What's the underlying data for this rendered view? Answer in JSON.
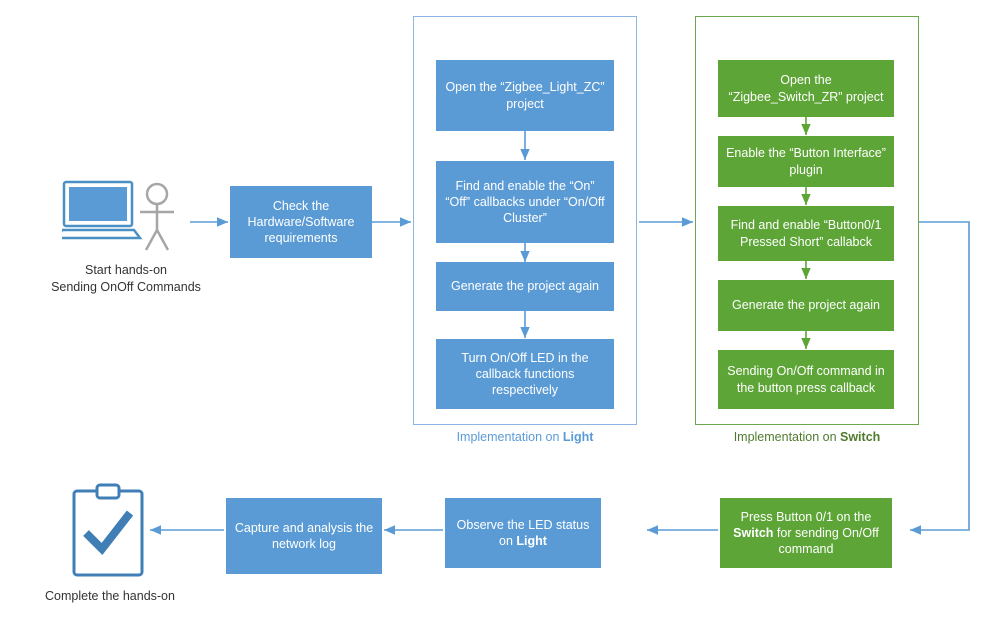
{
  "diagram": {
    "title": "Zigbee hands-on flow diagram",
    "colors": {
      "blue": "#5b9bd5",
      "green": "#5da536",
      "blue_caption": "#5b9bd5",
      "green_caption": "#4f7b2e",
      "arrow": "#5b9bd5",
      "group_blue_border": "#8eb4e3",
      "group_green_border": "#6aa84f"
    },
    "start": {
      "label_line1": "Start hands-on",
      "label_line2": "Sending OnOff Commands",
      "icon": "laptop-and-person-icon"
    },
    "end": {
      "label": "Complete the hands-on",
      "icon": "clipboard-check-icon"
    },
    "nodes": {
      "check_requirements": "Check the Hardware/Software requirements",
      "light": [
        "Open the “Zigbee_Light_ZC” project",
        "Find and enable the “On” “Off” callbacks under “On/Off Cluster”",
        "Generate the project again",
        "Turn On/Off LED in the callback functions respectively"
      ],
      "switch": [
        "Open the “Zigbee_Switch_ZR” project",
        "Enable the “Button Interface” plugin",
        "Find and enable “Button0/1 Pressed Short” callabck",
        "Generate the project again",
        "Sending On/Off command in the button press callback"
      ],
      "press_button": {
        "part1": "Press Button 0/1 on the ",
        "bold": "Switch",
        "part2": " for sending On/Off command"
      },
      "observe_led": {
        "part1": "Observe the LED status on ",
        "bold": "Light"
      },
      "capture_log": "Capture and analysis the network log"
    },
    "captions": {
      "light": {
        "prefix": "Implementation on ",
        "bold": "Light"
      },
      "switch": {
        "prefix": "Implementation on ",
        "bold": "Switch"
      }
    }
  }
}
